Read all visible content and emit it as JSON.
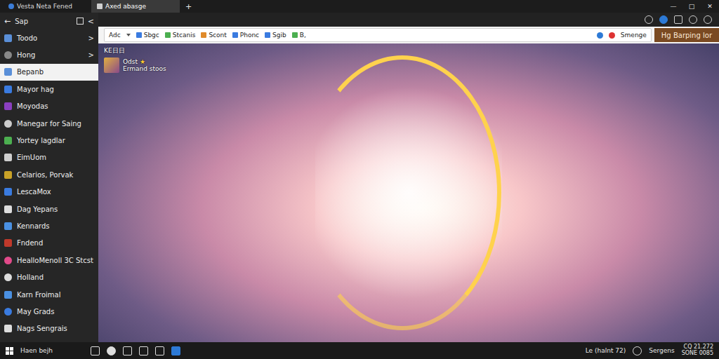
{
  "window": {
    "tabs": [
      {
        "label": "Vesta Neta Fened",
        "selected": false
      },
      {
        "label": "Axed abasge",
        "selected": true
      }
    ],
    "new_tab": "+",
    "controls": [
      "—",
      "□",
      "✕"
    ]
  },
  "sidebar": {
    "nav": {
      "back": "←",
      "title": "Sap",
      "collapse": "<"
    },
    "items": [
      {
        "label": "Toodo",
        "selected": false,
        "arrow": ">"
      },
      {
        "label": "Hong",
        "selected": false,
        "arrow": ">"
      },
      {
        "label": "Bepanb",
        "selected": true
      },
      {
        "label": "Mayor hag",
        "selected": false
      },
      {
        "label": "Moyodas",
        "selected": false
      },
      {
        "label": "Manegar for Saing",
        "selected": false
      },
      {
        "label": "Yortey lagdlar",
        "selected": false
      },
      {
        "label": "EimUom",
        "selected": false
      },
      {
        "label": "Celarios, Porvak",
        "selected": false
      },
      {
        "label": "LescaMox",
        "selected": false
      },
      {
        "label": "Dag Yepans",
        "selected": false
      },
      {
        "label": "Kennards",
        "selected": false
      },
      {
        "label": "Fndend",
        "selected": false
      },
      {
        "label": "HealloMenoll 3C Stcst",
        "selected": false
      },
      {
        "label": "Holland",
        "selected": false
      },
      {
        "label": "Karn Froimal",
        "selected": false
      },
      {
        "label": "May Grads",
        "selected": false
      },
      {
        "label": "Nags Sengrais",
        "selected": false
      }
    ]
  },
  "bookmarks": {
    "first": "Adc",
    "items": [
      "Sbgc",
      "Stcanis",
      "Scont",
      "Phonc",
      "Sgib",
      "B,"
    ],
    "menu": "Smenge",
    "button": "Hg Barping lor"
  },
  "overlay": {
    "heading": "KE日日",
    "name": "Odst",
    "star": "★",
    "subtitle": "Ermand stoos"
  },
  "taskbar": {
    "search": "Haen bejh",
    "tray_left": "Le (halnt 72)",
    "tray_user": "Sergens",
    "time": "CQ 21.272",
    "date": "SONE 0085"
  }
}
